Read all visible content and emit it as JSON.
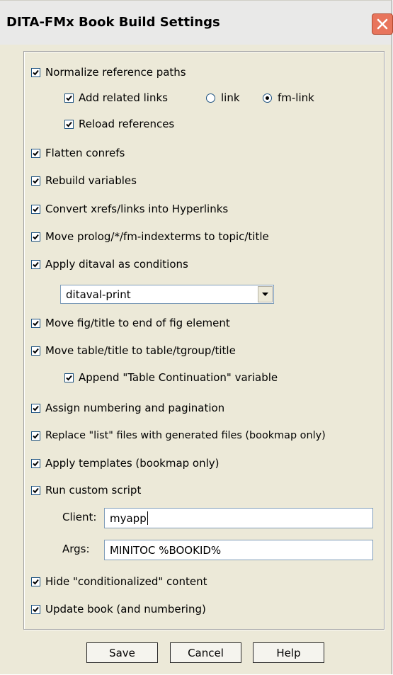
{
  "window": {
    "title": "DITA-FMx Book Build Settings"
  },
  "options": {
    "normalize": {
      "label": "Normalize reference paths",
      "checked": true
    },
    "add_related_links": {
      "label": "Add related links",
      "checked": true
    },
    "link_type": {
      "options": [
        "link",
        "fm-link"
      ],
      "selected": "fm-link"
    },
    "reload_references": {
      "label": "Reload references",
      "checked": true
    },
    "flatten_conrefs": {
      "label": "Flatten conrefs",
      "checked": true
    },
    "rebuild_variables": {
      "label": "Rebuild variables",
      "checked": true
    },
    "convert_xrefs": {
      "label": "Convert xrefs/links into Hyperlinks",
      "checked": true
    },
    "move_prolog": {
      "label": "Move prolog/*/fm-indexterms to topic/title",
      "checked": true
    },
    "apply_ditaval": {
      "label": "Apply ditaval as conditions",
      "checked": true
    },
    "ditaval_select": {
      "value": "ditaval-print"
    },
    "move_fig_title": {
      "label": "Move fig/title to end of fig element",
      "checked": true
    },
    "move_table_title": {
      "label": "Move table/title to table/tgroup/title",
      "checked": true
    },
    "append_table_cont": {
      "label": "Append \"Table Continuation\" variable",
      "checked": true
    },
    "assign_numbering": {
      "label": "Assign numbering and pagination",
      "checked": true
    },
    "replace_list_files": {
      "label": "Replace \"list\" files with generated files (bookmap only)",
      "checked": true
    },
    "apply_templates": {
      "label": "Apply templates (bookmap only)",
      "checked": true
    },
    "run_custom_script": {
      "label": "Run custom script",
      "checked": true
    },
    "client": {
      "label": "Client:",
      "value": "myapp"
    },
    "args": {
      "label": "Args:",
      "value": "MINITOC %BOOKID%"
    },
    "hide_conditionalized": {
      "label": "Hide \"conditionalized\" content",
      "checked": true
    },
    "update_book": {
      "label": "Update book (and numbering)",
      "checked": true
    }
  },
  "buttons": {
    "save": "Save",
    "cancel": "Cancel",
    "help": "Help"
  },
  "colors": {
    "dialog_bg": "#ece9d8",
    "close_button": "#e8755c",
    "checkbox_border": "#1c5180"
  }
}
